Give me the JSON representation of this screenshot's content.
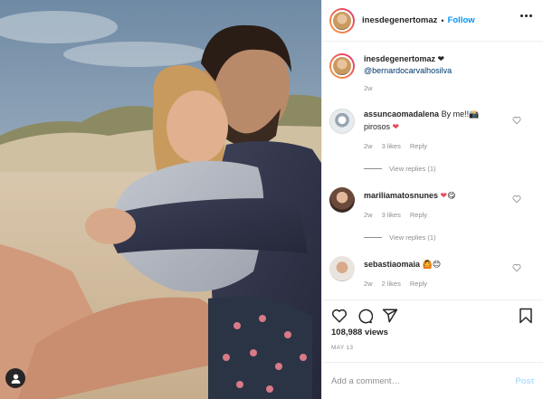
{
  "header": {
    "username": "inesdegenertomaz",
    "separator": "•",
    "follow_label": "Follow"
  },
  "caption": {
    "username": "inesdegenertomaz",
    "heart": "❤",
    "mention": "@bernardocarvalhosilva",
    "age": "2w"
  },
  "comments": [
    {
      "username": "assuncaomadalena",
      "text": "By me!!",
      "emoji": "📸",
      "text2": "pirosos",
      "emoji2": "❤",
      "age": "2w",
      "likes": "3 likes",
      "reply": "Reply",
      "view_replies": "View replies (1)"
    },
    {
      "username": "mariliamatosnunes",
      "emoji": "❤",
      "emoji2": "😋",
      "age": "2w",
      "likes": "3 likes",
      "reply": "Reply",
      "view_replies": "View replies (1)"
    },
    {
      "username": "sebastiaomaia",
      "emoji": "🙆",
      "emoji2": "😊",
      "age": "2w",
      "likes": "2 likes",
      "reply": "Reply"
    }
  ],
  "stats": {
    "views": "108,988 views",
    "date": "MAY 13"
  },
  "add_comment": {
    "placeholder": "Add a comment…",
    "post_label": "Post"
  },
  "colors": {
    "link_blue": "#0095f6",
    "mention_blue": "#00376b",
    "muted_gray": "#8e8e8e",
    "heart_red": "#ed4956",
    "post_disabled": "#b2dffc"
  },
  "icons": [
    "more-options-icon",
    "heart-icon",
    "comment-icon",
    "share-icon",
    "bookmark-icon",
    "user-tag-icon"
  ]
}
